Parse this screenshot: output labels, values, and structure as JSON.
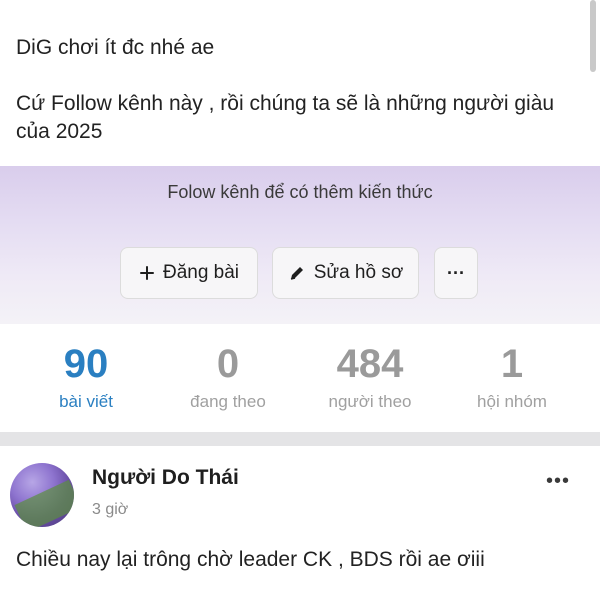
{
  "post_top": {
    "line0": "...",
    "line1": "DiG chơi ít đc nhé ae",
    "line2": "Cứ Follow kênh này , rồi chúng ta sẽ là những người giàu của 2025"
  },
  "profile": {
    "bio": "Folow kênh để có thêm kiến thức",
    "buttons": {
      "post_label": "Đăng bài",
      "edit_label": "Sửa hồ sơ",
      "more_label": "···"
    },
    "stats": [
      {
        "value": "90",
        "label": "bài viết"
      },
      {
        "value": "0",
        "label": "đang theo"
      },
      {
        "value": "484",
        "label": "người theo"
      },
      {
        "value": "1",
        "label": "hội nhóm"
      }
    ]
  },
  "feed_post": {
    "author": "Người Do Thái",
    "time": "3 giờ",
    "more_label": "•••",
    "body": "Chiều nay lại trông chờ leader CK , BDS rồi ae ơiii"
  },
  "colors": {
    "accent": "#2a7fc1",
    "band_top": "#d9cdec"
  }
}
